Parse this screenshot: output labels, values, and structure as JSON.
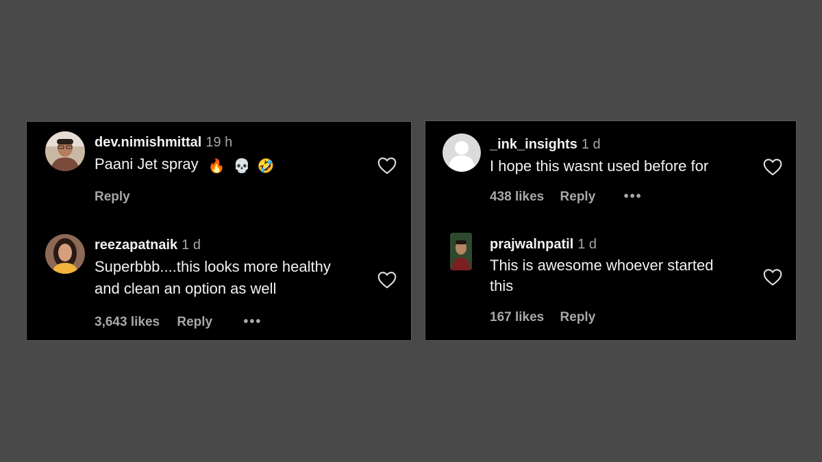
{
  "left_panel": {
    "comments": [
      {
        "username": "dev.nimishmittal",
        "time": "19 h",
        "text": "Paani Jet spray",
        "emojis": [
          "🔥",
          "💀",
          "🤣"
        ],
        "reply_label": "Reply"
      },
      {
        "username": "reezapatnaik",
        "time": "1 d",
        "text_lines": [
          "Superbbb....this looks more healthy",
          "and clean an option as well"
        ],
        "likes": "3,643 likes",
        "reply_label": "Reply",
        "more_label": "•••"
      }
    ]
  },
  "right_panel": {
    "comments": [
      {
        "username": "_ink_insights",
        "time": "1 d",
        "text": "I hope this wasnt used before for",
        "likes": "438 likes",
        "reply_label": "Reply",
        "more_label": "•••"
      },
      {
        "username": "prajwalnpatil",
        "time": "1 d",
        "text_lines": [
          "This is awesome whoever started",
          "this"
        ],
        "likes": "167 likes",
        "reply_label": "Reply"
      }
    ]
  },
  "icons": {
    "like": "heart-outline-icon",
    "more": "more-options-icon",
    "avatar_placeholder": "default-avatar-icon"
  },
  "colors": {
    "background": "#494949",
    "panel": "#000000",
    "text_primary": "#f2f2f2",
    "text_secondary": "#a8a8a8"
  }
}
